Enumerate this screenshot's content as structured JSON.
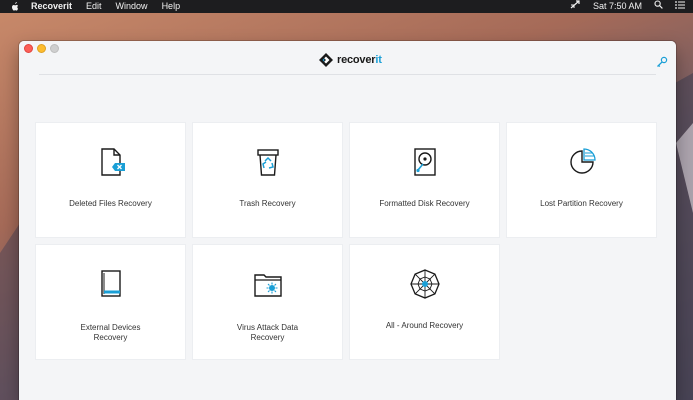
{
  "menubar": {
    "app_name": "Recoverit",
    "items": [
      "Edit",
      "Window",
      "Help"
    ],
    "clock": "Sat 7:50 AM"
  },
  "window": {
    "brand": {
      "prefix": "recover",
      "suffix": "it"
    }
  },
  "cards": [
    {
      "label": "Deleted Files Recovery",
      "icon": "deleted-file-icon"
    },
    {
      "label": "Trash Recovery",
      "icon": "trash-recycle-icon"
    },
    {
      "label": "Formatted Disk Recovery",
      "icon": "formatted-disk-icon"
    },
    {
      "label": "Lost Partition Recovery",
      "icon": "lost-partition-icon"
    },
    {
      "label": "External Devices\nRecovery",
      "icon": "external-device-icon"
    },
    {
      "label": "Virus Attack Data\nRecovery",
      "icon": "virus-folder-icon"
    },
    {
      "label": "All - Around Recovery",
      "icon": "all-around-web-icon"
    }
  ],
  "colors": {
    "accent": "#1a9fd6",
    "icon_stroke": "#1a1a1a",
    "card_bg": "#ffffff",
    "window_bg": "#f4f5f7"
  }
}
